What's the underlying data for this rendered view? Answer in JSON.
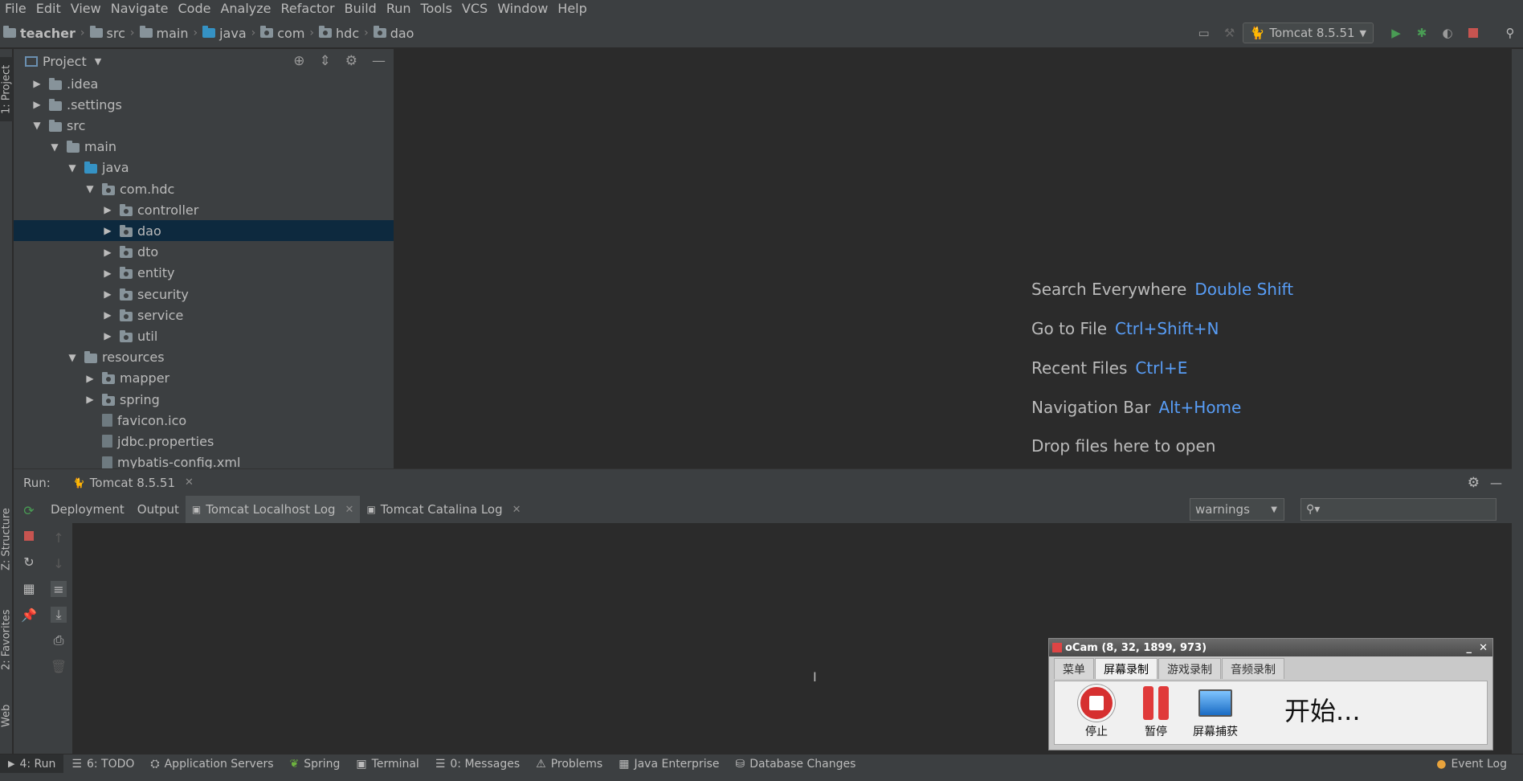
{
  "menu": [
    "File",
    "Edit",
    "View",
    "Navigate",
    "Code",
    "Analyze",
    "Refactor",
    "Build",
    "Run",
    "Tools",
    "VCS",
    "Window",
    "Help"
  ],
  "breadcrumb": [
    "teacher",
    "src",
    "main",
    "java",
    "com",
    "hdc",
    "dao"
  ],
  "run_config": "Tomcat 8.5.51",
  "left_strip": {
    "project": "1: Project",
    "structure": "Z: Structure",
    "favorites": "2: Favorites",
    "web": "Web"
  },
  "project_panel": {
    "title": "Project",
    "tree": [
      {
        "label": ".idea",
        "expanded": false
      },
      {
        "label": ".settings",
        "expanded": false
      },
      {
        "label": "src",
        "expanded": true
      },
      {
        "label": "main",
        "expanded": true
      },
      {
        "label": "java",
        "expanded": true
      },
      {
        "label": "com.hdc",
        "expanded": true
      },
      {
        "label": "controller",
        "expanded": false
      },
      {
        "label": "dao",
        "expanded": false,
        "selected": true
      },
      {
        "label": "dto",
        "expanded": false
      },
      {
        "label": "entity",
        "expanded": false
      },
      {
        "label": "security",
        "expanded": false
      },
      {
        "label": "service",
        "expanded": false
      },
      {
        "label": "util",
        "expanded": false
      },
      {
        "label": "resources",
        "expanded": true
      },
      {
        "label": "mapper",
        "expanded": false
      },
      {
        "label": "spring",
        "expanded": false
      },
      {
        "label": "favicon.ico"
      },
      {
        "label": "jdbc.properties"
      },
      {
        "label": "mybatis-config.xml"
      }
    ]
  },
  "editor_hints": [
    {
      "label": "Search Everywhere",
      "key": "Double Shift"
    },
    {
      "label": "Go to File",
      "key": "Ctrl+Shift+N"
    },
    {
      "label": "Recent Files",
      "key": "Ctrl+E"
    },
    {
      "label": "Navigation Bar",
      "key": "Alt+Home"
    },
    {
      "label": "Drop files here to open",
      "key": ""
    }
  ],
  "run_panel": {
    "label": "Run:",
    "config_tab": "Tomcat 8.5.51",
    "tabs": [
      "Deployment",
      "Output",
      "Tomcat Localhost Log",
      "Tomcat Catalina Log"
    ],
    "filter": "warnings"
  },
  "bottom_tabs": [
    "4: Run",
    "6: TODO",
    "Application Servers",
    "Spring",
    "Terminal",
    "0: Messages",
    "Problems",
    "Java Enterprise",
    "Database Changes"
  ],
  "event_log": "Event Log",
  "ocam": {
    "title": "oCam (8, 32, 1899, 973)",
    "tabs": [
      "菜单",
      "屏幕录制",
      "游戏录制",
      "音频录制"
    ],
    "stop": "停止",
    "pause": "暂停",
    "capture": "屏幕捕获",
    "status": "开始..."
  }
}
